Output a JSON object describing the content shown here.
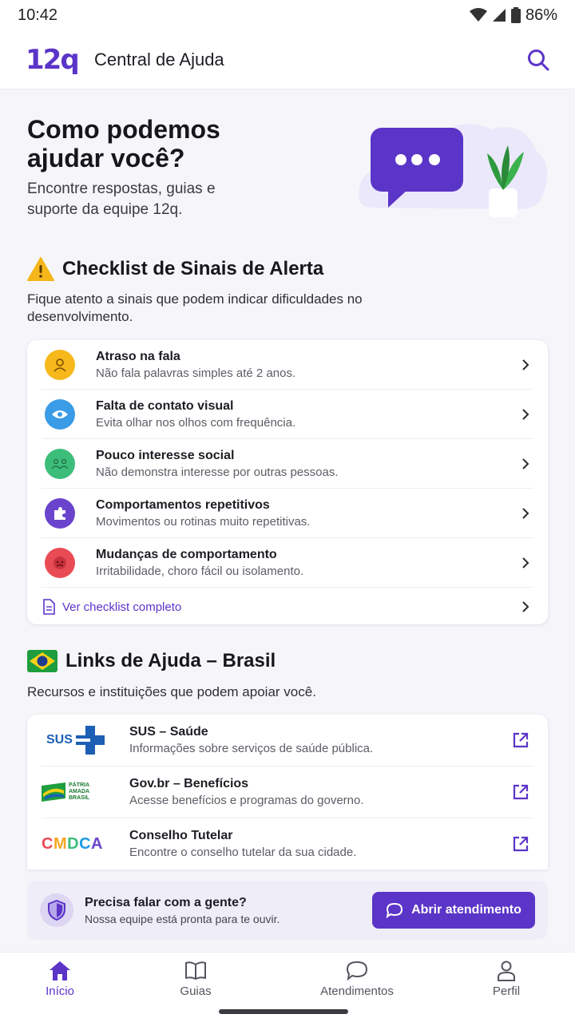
{
  "status_bar": {
    "time": "10:42",
    "battery": "86%"
  },
  "app_bar": {
    "logo": "12q",
    "title": "Central de Ajuda",
    "search_icon": "search-icon"
  },
  "hero": {
    "title": "Como podemos ajudar você?",
    "subtitle": "Encontre respostas, guias e suporte da equipe 12q."
  },
  "checklist": {
    "title": "Checklist de Sinais de Alerta",
    "subtitle": "Fique atento a sinais que podem indicar dificuldades no desenvolvimento.",
    "items": [
      {
        "title": "Atraso na fala",
        "desc": "Não fala palavras simples até 2 anos.",
        "icon": "speech-person-icon",
        "color": "#f6b81b"
      },
      {
        "title": "Falta de contato visual",
        "desc": "Evita olhar nos olhos com frequência.",
        "icon": "eye-icon",
        "color": "#3a9be6"
      },
      {
        "title": "Pouco interesse social",
        "desc": "Não demonstra interesse por outras pessoas.",
        "icon": "people-icon",
        "color": "#3dbd7a"
      },
      {
        "title": "Comportamentos repetitivos",
        "desc": "Movimentos ou rotinas muito repetitivas.",
        "icon": "puzzle-icon",
        "color": "#6a44cc"
      },
      {
        "title": "Mudanças de comportamento",
        "desc": "Irritabilidade, choro fácil ou isolamento.",
        "icon": "angry-face-icon",
        "color": "#e94b55"
      }
    ],
    "see_all": "Ver checklist completo"
  },
  "links": {
    "title": "Links de Ajuda – Brasil",
    "subtitle": "Recursos e instituições que podem apoiar você.",
    "items": [
      {
        "title": "SUS – Saúde",
        "desc": "Informações sobre serviços de saúde pública.",
        "brand": "SUS"
      },
      {
        "title": "Gov.br – Benefícios",
        "desc": "Acesse benefícios e programas do governo.",
        "brand": "PÁTRIA AMADA BRASIL"
      },
      {
        "title": "Conselho Tutelar",
        "desc": "Encontre o conselho tutelar da sua cidade.",
        "brand": "CMDCA"
      }
    ]
  },
  "help_banner": {
    "title": "Precisa falar com a gente?",
    "desc": "Nossa equipe está pronta para te ouvir.",
    "cta": "Abrir atendimento"
  },
  "bottom_nav": [
    {
      "label": "Início",
      "icon": "home-icon",
      "active": true
    },
    {
      "label": "Guias",
      "icon": "book-icon",
      "active": false
    },
    {
      "label": "Atendimentos",
      "icon": "chat-icon",
      "active": false
    },
    {
      "label": "Perfil",
      "icon": "person-icon",
      "active": false
    }
  ],
  "colors": {
    "accent": "#5b34c8",
    "background": "#f6f5f9"
  }
}
